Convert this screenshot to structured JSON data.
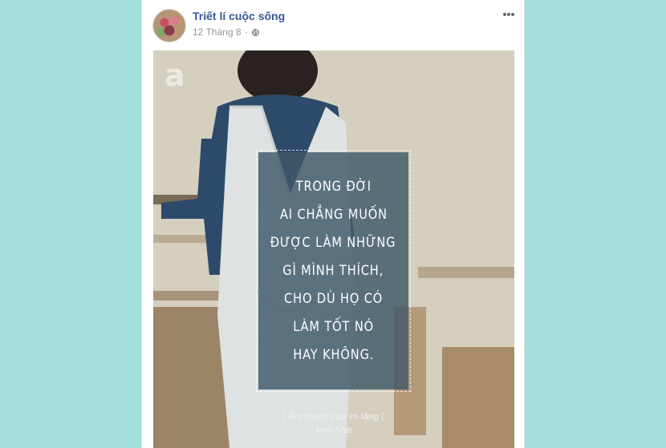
{
  "post": {
    "page_name": "Triết lí cuộc sống",
    "date": "12 Tháng 8",
    "separator": "·",
    "privacy_icon": "globe-icon",
    "menu_icon": "more-dots-icon"
  },
  "photo": {
    "watermark_icon": "afamily-logo-icon",
    "quote_lines": [
      "TRONG ĐỜI",
      "AI CHẲNG MUỐN",
      "ĐƯỢC LÀM NHỮNG",
      "GÌ MÌNH THÍCH,",
      "CHO DÙ HỌ CÓ",
      "LÀM TỐT NÓ",
      "HAY KHÔNG."
    ],
    "caption": "| Âm thanh của im lặng |",
    "author": "Minh Nhật"
  },
  "colors": {
    "background": "#a3e0dc",
    "link": "#365899",
    "meta": "#90949c",
    "quote_box": "#405868"
  }
}
